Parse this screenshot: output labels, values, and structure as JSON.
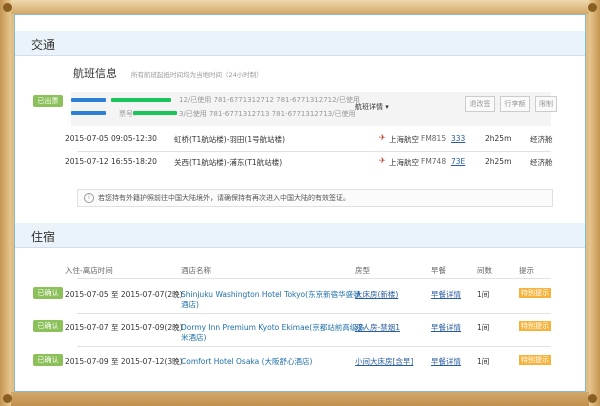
{
  "transport": {
    "title": "交通",
    "status_badge": "已出票",
    "flight_info_title": "航班信息",
    "flight_info_note": "所有航班起抵时间均为当地时间（24小时制）",
    "passengers": [
      {
        "number_suffix": "12/已使用 781-6771312712 781-6771312712/已使用"
      },
      {
        "number_suffix": "3/已使用 781-6771312713 781-6771312713/已使用"
      }
    ],
    "ticket_label": "票号:",
    "details_link": "航班详情",
    "buttons": [
      "退改签",
      "行李额",
      "限制"
    ],
    "flights": [
      {
        "date": "2015-07-05",
        "time": "09:05-12:30",
        "route": "虹桥(T1航站楼)-羽田(1号航站楼)",
        "airline": "上海航空",
        "flight_no": "FM815",
        "aircraft": "333",
        "duration": "2h25m",
        "cabin": "经济舱"
      },
      {
        "date": "2015-07-12",
        "time": "16:55-18:20",
        "route": "关西(T1航站楼)-浦东(T1航站楼)",
        "airline": "上海航空",
        "flight_no": "FM748",
        "aircraft": "73E",
        "duration": "2h25m",
        "cabin": "经济舱"
      }
    ],
    "notice": "若您持有外籍护照前往中国大陆境外，请确保持有再次进入中国大陆的有效签证。"
  },
  "hotel": {
    "title": "住宿",
    "headers": [
      "入住-离店时间",
      "酒店名称",
      "房型",
      "早餐",
      "间数",
      "提示"
    ],
    "rows": [
      {
        "status": "已确认",
        "dates": "2015-07-05 至 2015-07-07(2晚)",
        "name_line1": "Shinjuku Washington Hotel Tokyo(东京新宿华盛顿",
        "name_line2": "酒店)",
        "room": "大床房(新楼)",
        "breakfast": "早餐详情",
        "rooms": "1间",
        "tip": "特别提示"
      },
      {
        "status": "已确认",
        "dates": "2015-07-07 至 2015-07-09(2晚)",
        "name_line1": "Dormy Inn Premium Kyoto Ekimae(京都站前高级多",
        "name_line2": "米酒店)",
        "room": "双人房-禁烟1",
        "breakfast": "早餐详情",
        "rooms": "1间",
        "tip": "特别提示"
      },
      {
        "status": "已确认",
        "dates": "2015-07-09 至 2015-07-12(3晚)",
        "name_line1": "Comfort Hotel Osaka (大阪舒心酒店)",
        "name_line2": "",
        "room": "小间大床房[含早]",
        "breakfast": "早餐详情",
        "rooms": "1间",
        "tip": "特别提示"
      }
    ]
  },
  "colors": {
    "accent_green": "#8cc05a",
    "tip_orange": "#f8b33d",
    "link_blue": "#2a5d9f",
    "airline_red": "#c0392b"
  }
}
